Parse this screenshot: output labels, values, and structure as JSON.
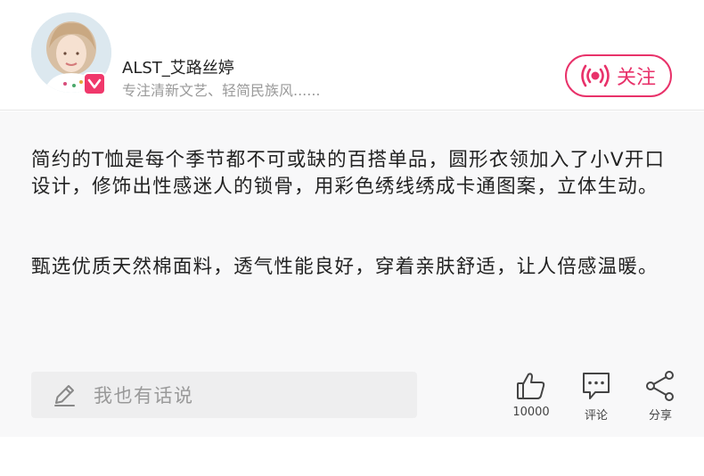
{
  "author": {
    "name": "ALST_艾路丝婷",
    "description": "专注清新文艺、轻简民族风......",
    "verified_icon": "v-badge-icon"
  },
  "follow": {
    "label": "关注",
    "icon": "broadcast-icon"
  },
  "article": {
    "paragraph1": "简约的T恤是每个季节都不可或缺的百搭单品，圆形衣领加入了小V开口设计，修饰出性感迷人的锁骨，用彩色绣线绣成卡通图案，立体生动。",
    "paragraph2": "甄选优质天然棉面料，透气性能良好，穿着亲肤舒适，让人倍感温暖。"
  },
  "comment_input": {
    "placeholder": "我也有话说",
    "icon": "pencil-icon"
  },
  "actions": {
    "like": {
      "label": "10000",
      "icon": "thumbs-up-icon"
    },
    "comment": {
      "label": "评论",
      "icon": "comment-icon"
    },
    "share": {
      "label": "分享",
      "icon": "share-icon"
    }
  },
  "colors": {
    "accent": "#e8326a",
    "badge": "#f0386b",
    "content_bg": "#f8f8f9",
    "input_bg": "#eeeeef"
  }
}
